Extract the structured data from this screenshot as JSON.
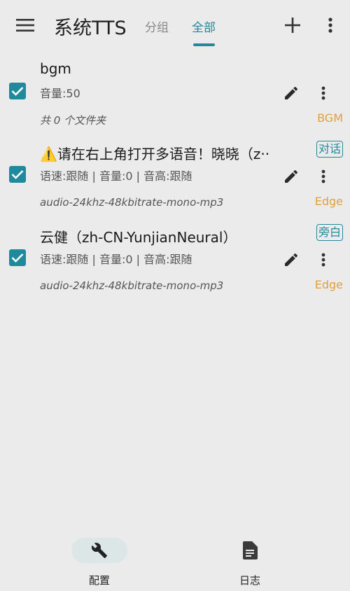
{
  "appbar": {
    "title": "系统TTS",
    "tabs": [
      {
        "label": "分组",
        "selected": false
      },
      {
        "label": "全部",
        "selected": true
      }
    ],
    "icons": {
      "menu": "menu-icon",
      "add": "plus-icon",
      "more": "more-vert-icon"
    },
    "accent_color": "#23889a"
  },
  "items": [
    {
      "checked": true,
      "name": "bgm",
      "info": "音量:50",
      "format": "共 0 个文件夹",
      "tag": "",
      "type": "BGM"
    },
    {
      "checked": true,
      "name": "⚠️请在右上角打开多语音！晓晓（z··",
      "info": "语速:跟随 | 音量:0 | 音高:跟随",
      "format": "audio-24khz-48kbitrate-mono-mp3",
      "tag": "对话",
      "type": "Edge"
    },
    {
      "checked": true,
      "name": "云健（zh-CN-YunjianNeural）",
      "info": "语速:跟随 | 音量:0 | 音高:跟随",
      "format": "audio-24khz-48kbitrate-mono-mp3",
      "tag": "旁白",
      "type": "Edge"
    }
  ],
  "bottom_nav": {
    "items": [
      {
        "label": "配置",
        "icon": "wrench-icon",
        "selected": true
      },
      {
        "label": "日志",
        "icon": "document-icon",
        "selected": false
      }
    ]
  },
  "colors": {
    "type_label": "#e0a040",
    "checkbox": "#1e8a9c"
  }
}
